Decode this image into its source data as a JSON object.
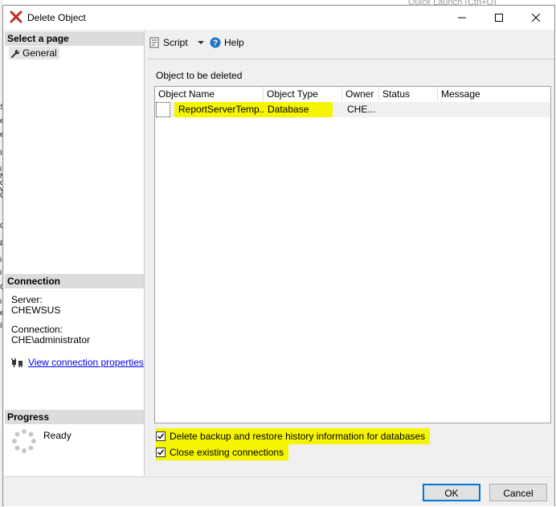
{
  "background": {
    "right_text": "Quick Launch (Ctrl+Q)",
    "left_chars": [
      "S",
      "e",
      "e",
      "I",
      "i",
      "o",
      "C",
      "C",
      "F",
      "i",
      "i",
      "C",
      "i",
      "e",
      "I",
      "N",
      "v"
    ]
  },
  "window": {
    "title": "Delete Object",
    "controls": {
      "minimize": "—",
      "maximize": "☐",
      "close": "✕"
    }
  },
  "sidebar": {
    "select_page_header": "Select a page",
    "pages": [
      {
        "label": "General",
        "icon": "wrench-icon"
      }
    ],
    "connection_header": "Connection",
    "server_label": "Server:",
    "server_value": "CHEWSUS",
    "connection_label": "Connection:",
    "connection_value": "CHE\\administrator",
    "view_connection_link": "View connection properties",
    "progress_header": "Progress",
    "progress_status": "Ready"
  },
  "toolbar": {
    "script_label": "Script",
    "help_label": "Help"
  },
  "main": {
    "objects_label": "Object to be deleted",
    "columns": [
      "Object Name",
      "Object Type",
      "Owner",
      "Status",
      "Message"
    ],
    "rows": [
      {
        "name": "ReportServerTemp...",
        "type": "Database",
        "owner": "CHE...",
        "status": "",
        "message": ""
      }
    ],
    "options": [
      {
        "label": "Delete backup and restore history information for databases",
        "checked": true
      },
      {
        "label": "Close existing connections",
        "checked": true
      }
    ]
  },
  "footer": {
    "ok_label": "OK",
    "cancel_label": "Cancel"
  },
  "colors": {
    "highlight": "#f5f500",
    "link": "#0000ee",
    "title_icon": "#c42b1c",
    "ok_border": "#0078d7",
    "help_icon": "#1e74c4"
  }
}
